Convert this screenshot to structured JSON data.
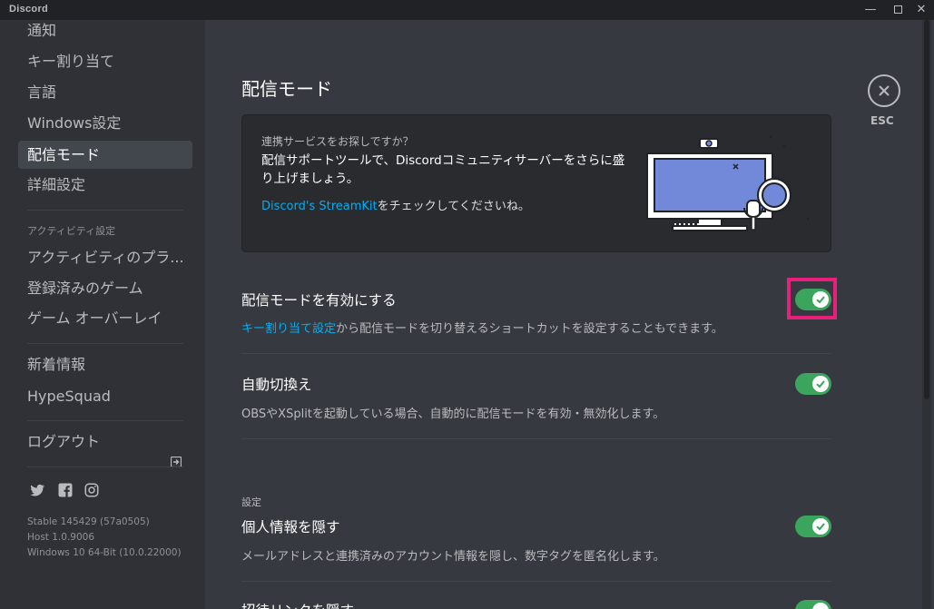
{
  "app": {
    "title": "Discord"
  },
  "window_controls": {
    "minimize": "—",
    "close": "✕"
  },
  "sidebar": {
    "items": [
      {
        "label": "通知"
      },
      {
        "label": "キー割り当て"
      },
      {
        "label": "言語"
      },
      {
        "label": "Windows設定"
      },
      {
        "label": "配信モード",
        "selected": true
      },
      {
        "label": "詳細設定"
      }
    ],
    "activity_header": "アクティビティ設定",
    "activity_items": [
      {
        "label": "アクティビティのプラ..."
      },
      {
        "label": "登録済みのゲーム"
      },
      {
        "label": "ゲーム オーバーレイ"
      }
    ],
    "misc_items": [
      {
        "label": "新着情報"
      },
      {
        "label": "HypeSquad"
      }
    ],
    "logout_label": "ログアウト",
    "social_icons": [
      "twitter-icon",
      "facebook-icon",
      "instagram-icon"
    ],
    "build_info": [
      "Stable 145429 (57a0505)",
      "Host 1.0.9006",
      "Windows 10 64-Bit (10.0.22000)"
    ]
  },
  "main": {
    "title": "配信モード",
    "close_label": "ESC",
    "promo": {
      "question": "連携サービスをお探しですか？",
      "text": "配信サポートツールで、Discordコミュニティサーバーをさらに盛り上げましょう。",
      "link": "Discord's StreamKit",
      "link_suffix": "をチェックしてくださいね。"
    },
    "settings": [
      {
        "title": "配信モードを有効にする",
        "desc_link": "キー割り当て設定",
        "desc": "から配信モードを切り替えるショートカットを設定することもできます。",
        "enabled": true
      },
      {
        "title": "自動切換え",
        "desc": "OBSやXSplitを起動している場合、自動的に配信モードを有効・無効化します。",
        "enabled": true
      }
    ],
    "section_header": "設定",
    "options": [
      {
        "title": "個人情報を隠す",
        "desc": "メールアドレスと連携済みのアカウント情報を隠し、数字タグを匿名化します。",
        "enabled": true
      },
      {
        "title": "招待リンクを隠す",
        "enabled": true
      }
    ]
  },
  "colors": {
    "accent_toggle": "#3ba55d",
    "link": "#00aff4",
    "highlight": "#e8207c"
  }
}
